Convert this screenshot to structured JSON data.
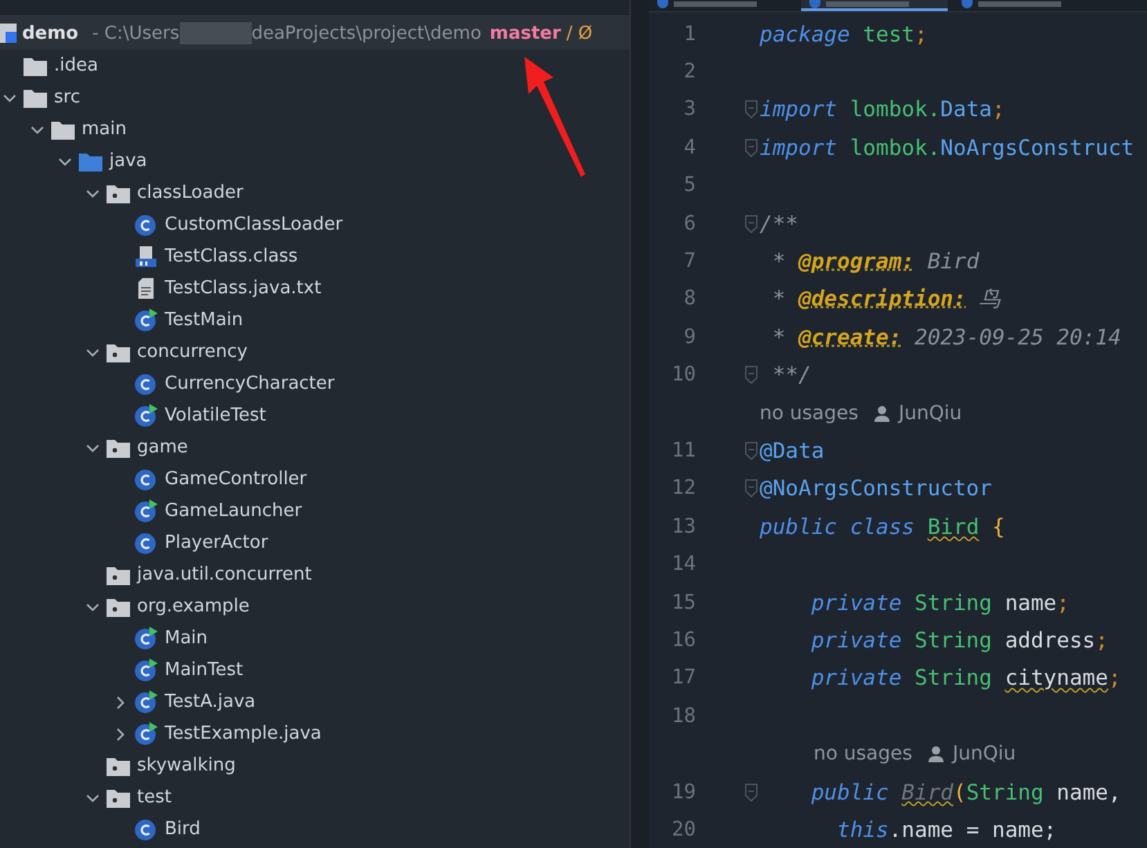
{
  "editor_tabs": [
    {
      "selected": false
    },
    {
      "selected": true
    },
    {
      "selected": false
    }
  ],
  "project": {
    "name": "demo",
    "path_start": "- C:\\Users",
    "path_end": "deaProjects\\project\\demo",
    "branch": "master",
    "branch_suffix": "/ Ø"
  },
  "tree": [
    {
      "name": ".idea",
      "kind": "folder"
    },
    {
      "name": "src",
      "kind": "folder",
      "expanded": true,
      "children": [
        {
          "name": "main",
          "kind": "folder",
          "expanded": true,
          "children": [
            {
              "name": "java",
              "kind": "source-folder",
              "expanded": true,
              "children": [
                {
                  "name": "classLoader",
                  "kind": "package",
                  "expanded": true,
                  "children": [
                    {
                      "name": "CustomClassLoader",
                      "kind": "class"
                    },
                    {
                      "name": "TestClass.class",
                      "kind": "class-file"
                    },
                    {
                      "name": "TestClass.java.txt",
                      "kind": "text-file"
                    },
                    {
                      "name": "TestMain",
                      "kind": "runnable"
                    }
                  ]
                },
                {
                  "name": "concurrency",
                  "kind": "package",
                  "expanded": true,
                  "children": [
                    {
                      "name": "CurrencyCharacter",
                      "kind": "class"
                    },
                    {
                      "name": "VolatileTest",
                      "kind": "runnable"
                    }
                  ]
                },
                {
                  "name": "game",
                  "kind": "package",
                  "expanded": true,
                  "children": [
                    {
                      "name": "GameController",
                      "kind": "class"
                    },
                    {
                      "name": "GameLauncher",
                      "kind": "runnable"
                    },
                    {
                      "name": "PlayerActor",
                      "kind": "class"
                    }
                  ]
                },
                {
                  "name": "java.util.concurrent",
                  "kind": "package"
                },
                {
                  "name": "org.example",
                  "kind": "package",
                  "expanded": true,
                  "children": [
                    {
                      "name": "Main",
                      "kind": "runnable"
                    },
                    {
                      "name": "MainTest",
                      "kind": "runnable"
                    },
                    {
                      "name": "TestA.java",
                      "kind": "runnable",
                      "expanded": false
                    },
                    {
                      "name": "TestExample.java",
                      "kind": "runnable",
                      "expanded": false
                    }
                  ]
                },
                {
                  "name": "skywalking",
                  "kind": "package"
                },
                {
                  "name": "test",
                  "kind": "package",
                  "expanded": true,
                  "children": [
                    {
                      "name": "Bird",
                      "kind": "class"
                    }
                  ]
                }
              ]
            }
          ]
        }
      ]
    }
  ],
  "code": [
    {
      "kind": "line",
      "number": "1",
      "fold": false,
      "tokens": [
        {
          "kind": "keyword",
          "text": "package"
        },
        {
          "kind": "name",
          "text": " test"
        },
        {
          "kind": "punct",
          "text": ";"
        }
      ]
    },
    {
      "kind": "line",
      "number": "2",
      "fold": false
    },
    {
      "kind": "line",
      "number": "3",
      "fold": true,
      "tokens": [
        {
          "kind": "keyword",
          "text": "import"
        },
        {
          "kind": "name",
          "text": " lombok."
        },
        {
          "kind": "type",
          "text": "Data"
        },
        {
          "kind": "punct",
          "text": ";"
        }
      ]
    },
    {
      "kind": "line",
      "number": "4",
      "fold": true,
      "tokens": [
        {
          "kind": "keyword",
          "text": "import"
        },
        {
          "kind": "name",
          "text": " lombok."
        },
        {
          "kind": "type",
          "text": "NoArgsConstruct"
        }
      ]
    },
    {
      "kind": "line",
      "number": "5",
      "fold": false
    },
    {
      "kind": "line",
      "number": "6",
      "fold": true,
      "tokens": [
        {
          "kind": "comment",
          "text": "/**"
        }
      ]
    },
    {
      "kind": "line",
      "number": "7",
      "fold": false,
      "tokens": [
        {
          "kind": "comment",
          "text": " * "
        },
        {
          "kind": "doc-tag",
          "text": "@program:"
        },
        {
          "kind": "comment",
          "text": " Bird"
        }
      ]
    },
    {
      "kind": "line",
      "number": "8",
      "fold": false,
      "tokens": [
        {
          "kind": "comment",
          "text": " * "
        },
        {
          "kind": "doc-tag",
          "text": "@description:"
        },
        {
          "kind": "comment",
          "text": " 鸟"
        }
      ]
    },
    {
      "kind": "line",
      "number": "9",
      "fold": false,
      "tokens": [
        {
          "kind": "comment",
          "text": " * "
        },
        {
          "kind": "doc-tag",
          "text": "@create:"
        },
        {
          "kind": "comment",
          "text": " 2023-09-25 20:14"
        }
      ]
    },
    {
      "kind": "line",
      "number": "10",
      "fold": true,
      "tokens": [
        {
          "kind": "comment",
          "text": " **/"
        }
      ]
    },
    {
      "kind": "hint",
      "usages": "no usages",
      "author": "JunQiu",
      "indent": false
    },
    {
      "kind": "line",
      "number": "11",
      "fold": true,
      "tokens": [
        {
          "kind": "annotation",
          "text": "@Data"
        }
      ]
    },
    {
      "kind": "line",
      "number": "12",
      "fold": true,
      "tokens": [
        {
          "kind": "annotation",
          "text": "@NoArgsConstructor"
        }
      ]
    },
    {
      "kind": "line",
      "number": "13",
      "fold": false,
      "tokens": [
        {
          "kind": "keyword",
          "text": "public class "
        },
        {
          "kind": "name-warn",
          "text": "Bird"
        },
        {
          "kind": "brace",
          "text": " {"
        }
      ]
    },
    {
      "kind": "line",
      "number": "14",
      "fold": false
    },
    {
      "kind": "line",
      "number": "15",
      "fold": false,
      "tokens": [
        {
          "kind": "keyword",
          "text": "    private "
        },
        {
          "kind": "name",
          "text": "String"
        },
        {
          "kind": "plain",
          "text": " name"
        },
        {
          "kind": "punct",
          "text": ";"
        }
      ]
    },
    {
      "kind": "line",
      "number": "16",
      "fold": false,
      "tokens": [
        {
          "kind": "keyword",
          "text": "    private "
        },
        {
          "kind": "name",
          "text": "String"
        },
        {
          "kind": "plain",
          "text": " address"
        },
        {
          "kind": "punct",
          "text": ";"
        }
      ]
    },
    {
      "kind": "line",
      "number": "17",
      "fold": false,
      "tokens": [
        {
          "kind": "keyword",
          "text": "    private "
        },
        {
          "kind": "name",
          "text": "String "
        },
        {
          "kind": "plain-warn",
          "text": "cityname"
        },
        {
          "kind": "punct",
          "text": ";"
        }
      ]
    },
    {
      "kind": "line",
      "number": "18",
      "fold": false
    },
    {
      "kind": "hint",
      "usages": "no usages",
      "author": "JunQiu",
      "indent": true
    },
    {
      "kind": "line",
      "number": "19",
      "fold": true,
      "tokens": [
        {
          "kind": "keyword",
          "text": "    public "
        },
        {
          "kind": "unused",
          "text": "Bird"
        },
        {
          "kind": "brace",
          "text": "("
        },
        {
          "kind": "name",
          "text": "String"
        },
        {
          "kind": "plain",
          "text": " name,"
        }
      ]
    },
    {
      "kind": "line",
      "number": "20",
      "fold": false,
      "tokens": [
        {
          "kind": "keyword",
          "text": "      this"
        },
        {
          "kind": "plain",
          "text": ".name = name;"
        }
      ]
    }
  ]
}
